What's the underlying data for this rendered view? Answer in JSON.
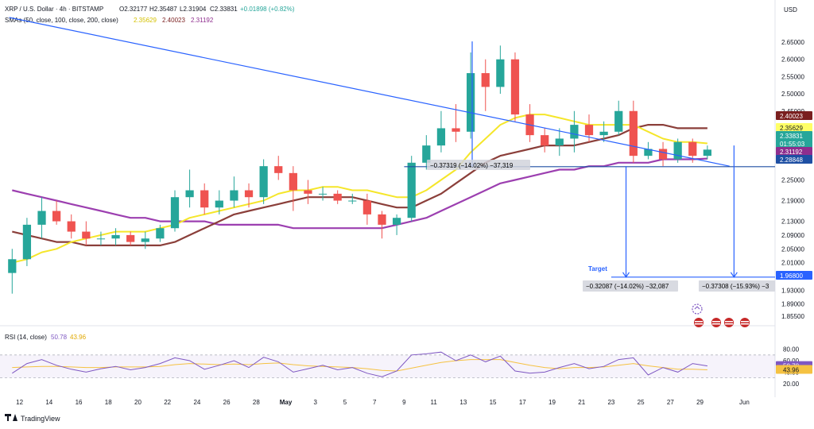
{
  "header": {
    "title": "XRP / U.S. Dollar · 4h · BITSTAMP",
    "ohlc": {
      "o": "O2.32177",
      "h": "H2.35487",
      "l": "L2.31904",
      "c": "C2.33831",
      "change": "+0.01898 (+0.82%)"
    },
    "sma_label": "SMAs (50, close, 100, close, 200, close)",
    "sma_values": [
      "2.35629",
      "2.40023",
      "2.31192"
    ],
    "currency": "USD"
  },
  "rsi": {
    "label": "RSI (14, close)",
    "value": "50.78",
    "ma_value": "43.96",
    "ticks": [
      "80.00",
      "60.00",
      "40.00",
      "20.00"
    ]
  },
  "x_ticks": [
    "12",
    "14",
    "16",
    "18",
    "20",
    "22",
    "24",
    "26",
    "28",
    "May",
    "3",
    "5",
    "7",
    "9",
    "11",
    "13",
    "15",
    "17",
    "19",
    "21",
    "23",
    "25",
    "27",
    "29",
    "Jun"
  ],
  "price_ticks": [
    "2.65000",
    "2.60000",
    "2.55000",
    "2.50000",
    "2.45000",
    "2.25000",
    "2.19000",
    "2.13000",
    "2.09000",
    "2.05000",
    "2.01000",
    "1.93000",
    "1.89000",
    "1.85500"
  ],
  "annotations": {
    "measure_1": "−0.37319 (−14.02%) −37,319",
    "measure_2": "−0.32087 (−14.02%) −32,087",
    "measure_3": "−0.37308 (−15.93%) −3",
    "target": "Target"
  },
  "price_tags": [
    {
      "text": "2.40023",
      "bg": "#7a1f1f",
      "fg": "#ffffff"
    },
    {
      "text": "2.35629",
      "bg": "#ffff66",
      "fg": "#131722"
    },
    {
      "text": "2.33831",
      "bg": "#26a69a",
      "fg": "#ffffff"
    },
    {
      "text": "01:55:03",
      "bg": "#26a69a",
      "fg": "#ffffff"
    },
    {
      "text": "2.31192",
      "bg": "#8e2e8e",
      "fg": "#ffffff"
    },
    {
      "text": "2.28848",
      "bg": "#1e4fa3",
      "fg": "#ffffff"
    },
    {
      "text": "1.96800",
      "bg": "#2962ff",
      "fg": "#ffffff"
    }
  ],
  "branding": "TradingView",
  "colors": {
    "up": "#26a69a",
    "down": "#ef5350",
    "sma50": "#f5e62a",
    "sma100": "#8b3f3a",
    "sma200": "#9c3fb0",
    "trend": "#2962ff",
    "rsi": "#7e57c2",
    "rsi_ma": "#f5c242"
  },
  "chart_data": {
    "type": "candlestick",
    "symbol": "XRP / U.S. Dollar",
    "interval": "4h",
    "yscale": "linear",
    "ylim": [
      1.85,
      2.68
    ],
    "x_range": [
      "Apr 11",
      "Jun 1"
    ],
    "sma_last": {
      "sma50": 2.35629,
      "sma100": 2.40023,
      "sma200": 2.31192
    },
    "last_close": 2.33831,
    "support_level": 2.28848,
    "target_level": 1.968,
    "trendline": [
      {
        "date": "Apr 13",
        "price": 2.665
      },
      {
        "date": "May 30",
        "price": 2.29
      }
    ],
    "rsi_last": 50.78,
    "rsi_ma_last": 43.96,
    "candles": [
      {
        "date": "Apr 11",
        "o": 1.98,
        "h": 2.05,
        "l": 1.92,
        "c": 2.02
      },
      {
        "date": "Apr 12",
        "o": 2.02,
        "h": 2.14,
        "l": 2.0,
        "c": 2.12
      },
      {
        "date": "Apr 13",
        "o": 2.12,
        "h": 2.2,
        "l": 2.08,
        "c": 2.16
      },
      {
        "date": "Apr 14",
        "o": 2.16,
        "h": 2.19,
        "l": 2.12,
        "c": 2.13
      },
      {
        "date": "Apr 15",
        "o": 2.13,
        "h": 2.15,
        "l": 2.08,
        "c": 2.1
      },
      {
        "date": "Apr 16",
        "o": 2.1,
        "h": 2.13,
        "l": 2.06,
        "c": 2.08
      },
      {
        "date": "Apr 17",
        "o": 2.08,
        "h": 2.1,
        "l": 2.06,
        "c": 2.08
      },
      {
        "date": "Apr 18",
        "o": 2.08,
        "h": 2.11,
        "l": 2.06,
        "c": 2.09
      },
      {
        "date": "Apr 19",
        "o": 2.09,
        "h": 2.1,
        "l": 2.06,
        "c": 2.07
      },
      {
        "date": "Apr 20",
        "o": 2.07,
        "h": 2.1,
        "l": 2.05,
        "c": 2.08
      },
      {
        "date": "Apr 21",
        "o": 2.08,
        "h": 2.12,
        "l": 2.07,
        "c": 2.11
      },
      {
        "date": "Apr 22",
        "o": 2.11,
        "h": 2.22,
        "l": 2.1,
        "c": 2.2
      },
      {
        "date": "Apr 23",
        "o": 2.2,
        "h": 2.28,
        "l": 2.17,
        "c": 2.22
      },
      {
        "date": "Apr 24",
        "o": 2.22,
        "h": 2.24,
        "l": 2.15,
        "c": 2.17
      },
      {
        "date": "Apr 25",
        "o": 2.17,
        "h": 2.22,
        "l": 2.15,
        "c": 2.19
      },
      {
        "date": "Apr 26",
        "o": 2.19,
        "h": 2.26,
        "l": 2.17,
        "c": 2.22
      },
      {
        "date": "Apr 27",
        "o": 2.22,
        "h": 2.24,
        "l": 2.17,
        "c": 2.2
      },
      {
        "date": "Apr 28",
        "o": 2.2,
        "h": 2.31,
        "l": 2.18,
        "c": 2.29
      },
      {
        "date": "Apr 29",
        "o": 2.29,
        "h": 2.32,
        "l": 2.25,
        "c": 2.27
      },
      {
        "date": "Apr 30",
        "o": 2.27,
        "h": 2.29,
        "l": 2.16,
        "c": 2.22
      },
      {
        "date": "May 1",
        "o": 2.22,
        "h": 2.25,
        "l": 2.18,
        "c": 2.21
      },
      {
        "date": "May 2",
        "o": 2.21,
        "h": 2.23,
        "l": 2.19,
        "c": 2.21
      },
      {
        "date": "May 3",
        "o": 2.21,
        "h": 2.22,
        "l": 2.18,
        "c": 2.19
      },
      {
        "date": "May 4",
        "o": 2.19,
        "h": 2.21,
        "l": 2.18,
        "c": 2.19
      },
      {
        "date": "May 5",
        "o": 2.19,
        "h": 2.21,
        "l": 2.12,
        "c": 2.15
      },
      {
        "date": "May 6",
        "o": 2.15,
        "h": 2.16,
        "l": 2.08,
        "c": 2.12
      },
      {
        "date": "May 7",
        "o": 2.12,
        "h": 2.15,
        "l": 2.09,
        "c": 2.14
      },
      {
        "date": "May 8",
        "o": 2.14,
        "h": 2.32,
        "l": 2.13,
        "c": 2.3
      },
      {
        "date": "May 9",
        "o": 2.3,
        "h": 2.38,
        "l": 2.28,
        "c": 2.35
      },
      {
        "date": "May 10",
        "o": 2.35,
        "h": 2.45,
        "l": 2.33,
        "c": 2.4
      },
      {
        "date": "May 11",
        "o": 2.4,
        "h": 2.47,
        "l": 2.36,
        "c": 2.39
      },
      {
        "date": "May 12",
        "o": 2.39,
        "h": 2.62,
        "l": 2.37,
        "c": 2.56
      },
      {
        "date": "May 13",
        "o": 2.56,
        "h": 2.6,
        "l": 2.45,
        "c": 2.52
      },
      {
        "date": "May 14",
        "o": 2.52,
        "h": 2.64,
        "l": 2.5,
        "c": 2.6
      },
      {
        "date": "May 15",
        "o": 2.6,
        "h": 2.62,
        "l": 2.42,
        "c": 2.44
      },
      {
        "date": "May 16",
        "o": 2.44,
        "h": 2.47,
        "l": 2.36,
        "c": 2.38
      },
      {
        "date": "May 17",
        "o": 2.38,
        "h": 2.4,
        "l": 2.33,
        "c": 2.35
      },
      {
        "date": "May 18",
        "o": 2.35,
        "h": 2.4,
        "l": 2.32,
        "c": 2.37
      },
      {
        "date": "May 19",
        "o": 2.37,
        "h": 2.45,
        "l": 2.33,
        "c": 2.41
      },
      {
        "date": "May 20",
        "o": 2.41,
        "h": 2.44,
        "l": 2.36,
        "c": 2.38
      },
      {
        "date": "May 21",
        "o": 2.38,
        "h": 2.42,
        "l": 2.36,
        "c": 2.39
      },
      {
        "date": "May 22",
        "o": 2.39,
        "h": 2.48,
        "l": 2.38,
        "c": 2.45
      },
      {
        "date": "May 23",
        "o": 2.45,
        "h": 2.48,
        "l": 2.3,
        "c": 2.32
      },
      {
        "date": "May 24",
        "o": 2.32,
        "h": 2.36,
        "l": 2.31,
        "c": 2.34
      },
      {
        "date": "May 25",
        "o": 2.34,
        "h": 2.36,
        "l": 2.29,
        "c": 2.31
      },
      {
        "date": "May 26",
        "o": 2.31,
        "h": 2.37,
        "l": 2.3,
        "c": 2.36
      },
      {
        "date": "May 27",
        "o": 2.36,
        "h": 2.37,
        "l": 2.3,
        "c": 2.32
      },
      {
        "date": "May 28",
        "o": 2.32,
        "h": 2.35,
        "l": 2.31,
        "c": 2.338
      }
    ],
    "sma50": [
      2.01,
      2.02,
      2.04,
      2.05,
      2.07,
      2.08,
      2.09,
      2.1,
      2.1,
      2.1,
      2.11,
      2.12,
      2.14,
      2.15,
      2.16,
      2.17,
      2.18,
      2.19,
      2.21,
      2.22,
      2.22,
      2.23,
      2.23,
      2.22,
      2.22,
      2.21,
      2.2,
      2.2,
      2.22,
      2.25,
      2.28,
      2.33,
      2.37,
      2.41,
      2.43,
      2.44,
      2.44,
      2.43,
      2.42,
      2.41,
      2.41,
      2.41,
      2.41,
      2.39,
      2.37,
      2.36,
      2.36,
      2.356
    ],
    "sma100": [
      2.1,
      2.09,
      2.08,
      2.07,
      2.07,
      2.06,
      2.06,
      2.06,
      2.06,
      2.06,
      2.06,
      2.07,
      2.09,
      2.11,
      2.13,
      2.15,
      2.16,
      2.17,
      2.18,
      2.19,
      2.2,
      2.2,
      2.2,
      2.2,
      2.19,
      2.18,
      2.17,
      2.17,
      2.19,
      2.21,
      2.24,
      2.27,
      2.3,
      2.32,
      2.33,
      2.34,
      2.35,
      2.35,
      2.35,
      2.36,
      2.37,
      2.38,
      2.4,
      2.41,
      2.41,
      2.4,
      2.4,
      2.4
    ],
    "sma200": [
      2.22,
      2.21,
      2.2,
      2.19,
      2.18,
      2.17,
      2.16,
      2.15,
      2.14,
      2.14,
      2.13,
      2.13,
      2.13,
      2.13,
      2.12,
      2.12,
      2.12,
      2.12,
      2.12,
      2.11,
      2.11,
      2.11,
      2.11,
      2.11,
      2.11,
      2.11,
      2.12,
      2.13,
      2.14,
      2.16,
      2.18,
      2.2,
      2.22,
      2.24,
      2.25,
      2.26,
      2.27,
      2.28,
      2.28,
      2.29,
      2.29,
      2.3,
      2.3,
      2.3,
      2.31,
      2.31,
      2.31,
      2.312
    ],
    "rsi": [
      38,
      55,
      62,
      52,
      45,
      40,
      46,
      50,
      44,
      48,
      55,
      65,
      60,
      45,
      52,
      60,
      48,
      66,
      58,
      40,
      46,
      52,
      44,
      48,
      38,
      32,
      42,
      70,
      72,
      75,
      60,
      70,
      58,
      68,
      42,
      38,
      40,
      48,
      55,
      46,
      50,
      62,
      65,
      35,
      48,
      40,
      55,
      50.78
    ],
    "rsi_ma": [
      48,
      49,
      50,
      50,
      49,
      48,
      48,
      49,
      49,
      49,
      50,
      53,
      55,
      54,
      53,
      54,
      53,
      55,
      56,
      53,
      51,
      50,
      49,
      48,
      46,
      43,
      42,
      47,
      52,
      57,
      60,
      62,
      62,
      62,
      57,
      52,
      48,
      46,
      48,
      48,
      49,
      52,
      55,
      51,
      48,
      45,
      45,
      43.96
    ]
  }
}
